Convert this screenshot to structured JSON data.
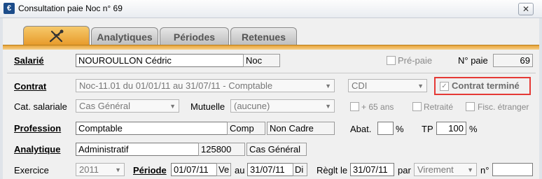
{
  "window": {
    "title": "Consultation paie Noc n° 69",
    "app_icon": "€",
    "close_label": "✕"
  },
  "tabs": [
    {
      "label": "",
      "icon": "tools-icon"
    },
    {
      "label": "Analytiques"
    },
    {
      "label": "Périodes"
    },
    {
      "label": "Retenues"
    }
  ],
  "salarie": {
    "label": "Salarié",
    "name": "NOUROULLON Cédric",
    "code": "Noc",
    "prepaie_label": "Pré-paie",
    "npaie_label": "N° paie",
    "npaie_value": "69"
  },
  "contrat": {
    "label": "Contrat",
    "value": "Noc-11.01 du 01/01/11 au 31/07/11 - Comptable",
    "type": "CDI",
    "termine_label": "Contrat terminé",
    "termine_checked": true
  },
  "categorie": {
    "label": "Cat. salariale",
    "value": "Cas Général",
    "mutuelle_label": "Mutuelle",
    "mutuelle_value": "(aucune)",
    "plus65_label": "+ 65 ans",
    "retraite_label": "Retraité",
    "fisc_label": "Fisc. étranger"
  },
  "profession": {
    "label": "Profession",
    "value": "Comptable",
    "code": "Comp",
    "statut": "Non Cadre",
    "abat_label": "Abat.",
    "abat_value": "",
    "pct1": "%",
    "tp_label": "TP",
    "tp_value": "100",
    "pct2": "%"
  },
  "analytique": {
    "label": "Analytique",
    "value": "Administratif",
    "code": "125800",
    "cas": "Cas Général"
  },
  "exercice": {
    "label": "Exercice",
    "value": "2011",
    "periode_label": "Période",
    "date_from": "01/07/11",
    "day_from": "Ve",
    "au_label": "au",
    "date_to": "31/07/11",
    "day_to": "Di",
    "reglt_label": "Règlt le",
    "reglt_date": "31/07/11",
    "par_label": "par",
    "mode": "Virement",
    "no_label": "n°",
    "no_value": ""
  },
  "colors": {
    "accent_tab": "#e79a2a",
    "highlight": "#e53935"
  }
}
